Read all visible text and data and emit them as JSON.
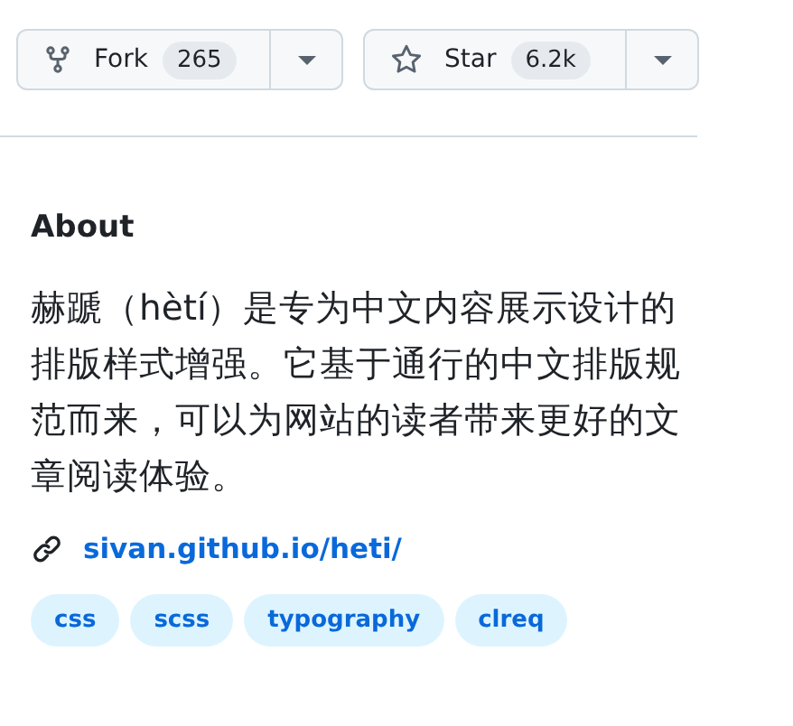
{
  "actions": [
    {
      "kind": "fork",
      "label": "Fork",
      "count": "265"
    },
    {
      "kind": "star",
      "label": "Star",
      "count": "6.2k"
    }
  ],
  "about": {
    "heading": "About",
    "description": "赫蹏（hètí）是专为中文内容展示设计的排版样式增强。它基于通行的中文排版规范而来，可以为网站的读者带来更好的文章阅读体验。",
    "link": "sivan.github.io/heti/",
    "topics": [
      "css",
      "scss",
      "typography",
      "clreq"
    ]
  }
}
